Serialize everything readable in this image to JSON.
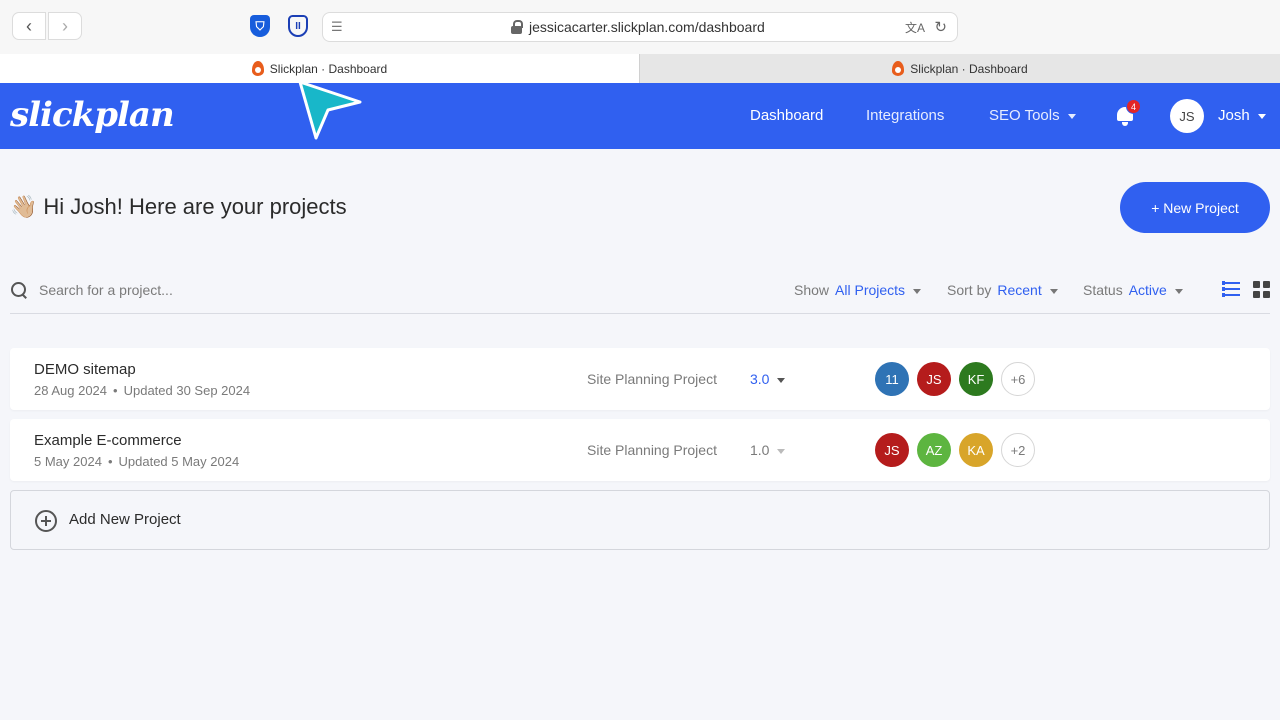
{
  "browser": {
    "url": "jessicacarter.slickplan.com/dashboard",
    "tabs": [
      {
        "label": "Slickplan · Dashboard",
        "active": true
      },
      {
        "label": "Slickplan · Dashboard",
        "active": false
      }
    ],
    "back_icon": "‹",
    "forward_icon": "›",
    "reader_icon": "☰",
    "translate_icon": "文A",
    "reload_icon": "↻",
    "bitwarden_glyph": "⛉",
    "proton_glyph": "II"
  },
  "header": {
    "logo": "slickplan",
    "nav": [
      {
        "label": "Dashboard"
      },
      {
        "label": "Integrations"
      },
      {
        "label": "SEO Tools"
      }
    ],
    "notification_count": "4",
    "user_initials": "JS",
    "user_name": "Josh",
    "brand_color": "#3060f0"
  },
  "main": {
    "wave_emoji": "👋🏼",
    "greeting": "Hi Josh! Here are your projects",
    "new_project_label": "+ New Project",
    "search_placeholder": "Search for a project...",
    "filters": {
      "show_label": "Show",
      "show_value": "All Projects",
      "sort_label": "Sort by",
      "sort_value": "Recent",
      "status_label": "Status",
      "status_value": "Active"
    },
    "projects": [
      {
        "name": "DEMO sitemap",
        "created": "28 Aug 2024",
        "dot": "•",
        "updated": "Updated 30 Sep 2024",
        "type": "Site Planning Project",
        "version": "3.0",
        "members": [
          {
            "initials": "11",
            "color": "#2f73b5"
          },
          {
            "initials": "JS",
            "color": "#b51c1c"
          },
          {
            "initials": "KF",
            "color": "#2d7a1f"
          },
          {
            "initials": "+6",
            "color": "#ffffff"
          }
        ]
      },
      {
        "name": "Example E-commerce",
        "created": "5 May 2024",
        "dot": "•",
        "updated": "Updated 5 May 2024",
        "type": "Site Planning Project",
        "version": "1.0",
        "members": [
          {
            "initials": "JS",
            "color": "#b51c1c"
          },
          {
            "initials": "AZ",
            "color": "#5db540"
          },
          {
            "initials": "KA",
            "color": "#d8a52a"
          },
          {
            "initials": "+2",
            "color": "#ffffff"
          }
        ]
      }
    ],
    "add_new_label": "Add New Project"
  }
}
